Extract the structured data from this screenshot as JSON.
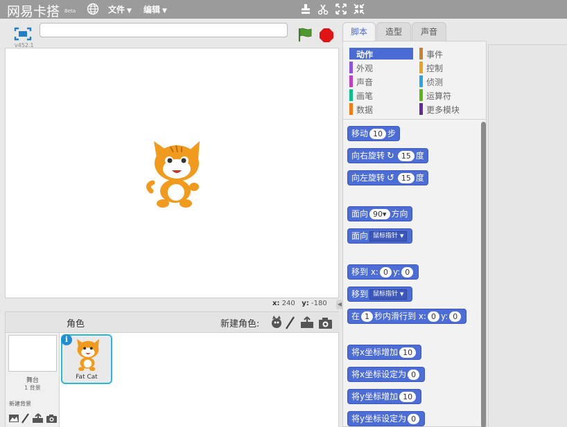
{
  "topbar": {
    "brand": "网易卡搭",
    "beta": "Beta",
    "menus": [
      {
        "label": "文件"
      },
      {
        "label": "编辑"
      }
    ]
  },
  "stage": {
    "version": "v452.1",
    "title_value": "",
    "coords": {
      "x_label": "x:",
      "x_value": "240",
      "y_label": "y:",
      "y_value": "-180"
    }
  },
  "sprites": {
    "header": "角色",
    "new_sprite_label": "新建角色:",
    "stage_label": "舞台",
    "stage_sub": "1 背景",
    "new_backdrop": "新建背景",
    "items": [
      {
        "name": "Fat Cat"
      }
    ]
  },
  "tabs": [
    {
      "label": "脚本"
    },
    {
      "label": "造型"
    },
    {
      "label": "声音"
    }
  ],
  "categories": [
    {
      "label": "动作",
      "color": "#4a6bd3"
    },
    {
      "label": "外观",
      "color": "#8a55d7"
    },
    {
      "label": "声音",
      "color": "#bb42c3"
    },
    {
      "label": "画笔",
      "color": "#0fbd8c"
    },
    {
      "label": "数据",
      "color": "#ee7d16"
    },
    {
      "label": "事件",
      "color": "#c88330"
    },
    {
      "label": "控制",
      "color": "#e1a91a"
    },
    {
      "label": "侦测",
      "color": "#2ca5e2"
    },
    {
      "label": "运算符",
      "color": "#5cb712"
    },
    {
      "label": "更多模块",
      "color": "#632d99"
    }
  ],
  "blocks": {
    "move": {
      "a": "移动",
      "n": "10",
      "b": "步"
    },
    "turn_right": {
      "a": "向右旋转",
      "n": "15",
      "b": "度"
    },
    "turn_left": {
      "a": "向左旋转",
      "n": "15",
      "b": "度"
    },
    "point_dir": {
      "a": "面向",
      "n": "90▾",
      "b": "方向"
    },
    "point_towards": {
      "a": "面向",
      "d": "鼠标指针"
    },
    "goto_xy": {
      "a": "移到 x:",
      "x": "0",
      "y_lbl": "y:",
      "y": "0"
    },
    "goto": {
      "a": "移到",
      "d": "鼠标指针"
    },
    "glide": {
      "a": "在",
      "n": "1",
      "b": "秒内滑行到 x:",
      "x": "0",
      "y_lbl": "y:",
      "y": "0"
    },
    "change_x": {
      "a": "将x坐标增加",
      "n": "10"
    },
    "set_x": {
      "a": "将x坐标设定为",
      "n": "0"
    },
    "change_y": {
      "a": "将y坐标增加",
      "n": "10"
    },
    "set_y": {
      "a": "将y坐标设定为",
      "n": "0"
    }
  }
}
